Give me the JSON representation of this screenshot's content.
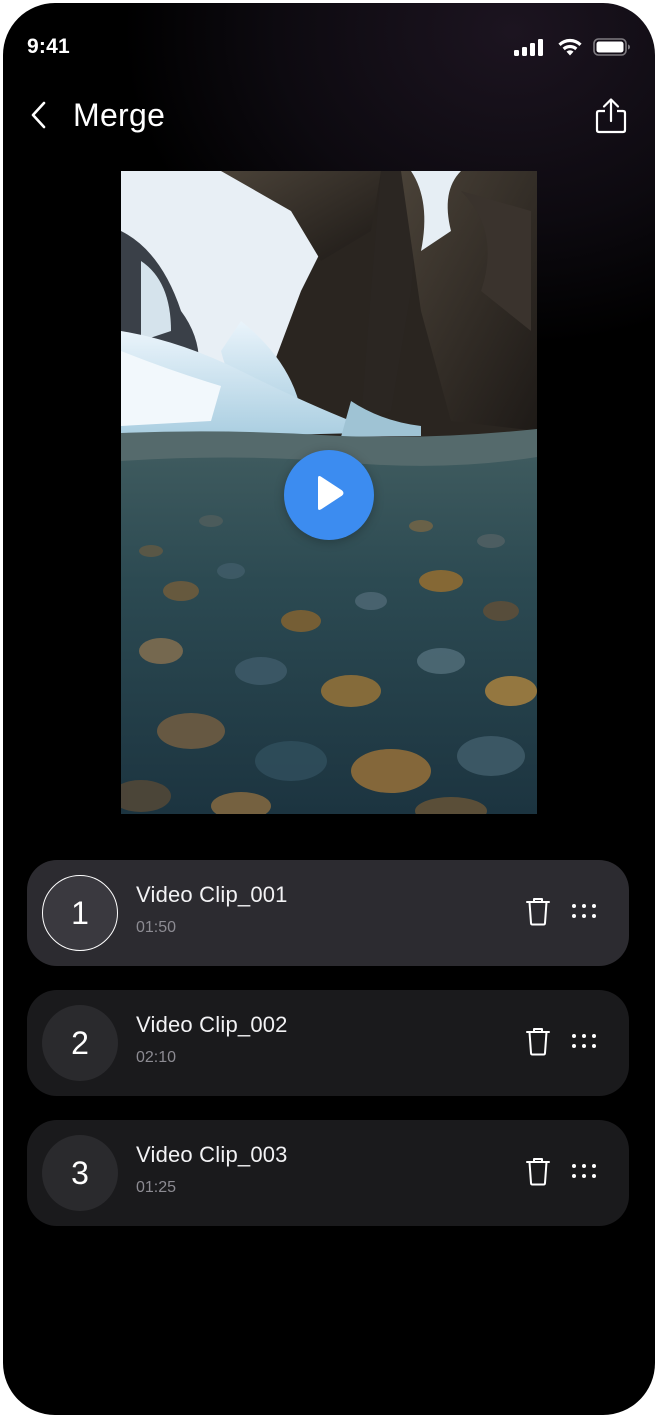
{
  "status_bar": {
    "time": "9:41",
    "icons": [
      "cellular-signal-icon",
      "wifi-icon",
      "battery-icon"
    ]
  },
  "nav": {
    "title": "Merge",
    "back_icon": "chevron-left-icon",
    "share_icon": "share-icon"
  },
  "preview": {
    "play_icon": "play-icon",
    "accent_color": "#3c8cf0"
  },
  "clips": [
    {
      "number": "1",
      "title": "Video Clip_001",
      "duration": "01:50",
      "selected": true
    },
    {
      "number": "2",
      "title": "Video Clip_002",
      "duration": "02:10",
      "selected": false
    },
    {
      "number": "3",
      "title": "Video Clip_003",
      "duration": "01:25",
      "selected": false
    }
  ],
  "clip_actions": {
    "delete_icon": "trash-icon",
    "drag_icon": "drag-handle-icon"
  },
  "colors": {
    "background": "#000000",
    "card": "#1a1a1c",
    "card_selected": "#2c2b30",
    "secondary_text": "#8c8b92"
  }
}
